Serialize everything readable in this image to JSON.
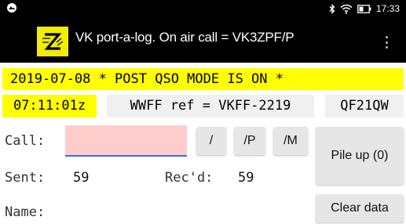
{
  "status": {
    "time": "17:33",
    "icons": [
      "status-app-icon",
      "bluetooth-icon",
      "wifi-icon",
      "battery-icon"
    ]
  },
  "app": {
    "title": "VK port-a-log. On air call = VK3ZPF/P",
    "logo_icon": "zpf-logo-icon"
  },
  "banner": {
    "text": "2019-07-08 * POST QSO MODE IS ON *"
  },
  "info": {
    "time": "07:11:01z",
    "wwff": "WWFF ref = VKFF-2219",
    "grid": "QF21QW"
  },
  "form": {
    "call_label": "Call:",
    "call_value": "",
    "call_placeholder": "",
    "sent_label": "Sent:",
    "sent_value": "59",
    "recd_label": "Rec'd:",
    "recd_value": "59",
    "name_label": "Name:"
  },
  "buttons": {
    "slash": "/",
    "slash_p": "/P",
    "slash_m": "/M",
    "pileup": "Pile up (0)",
    "clear": "Clear data"
  },
  "colors": {
    "highlight": "#ffff00",
    "call_field_bg": "#ffcccc",
    "appbar_bg": "#000000"
  }
}
